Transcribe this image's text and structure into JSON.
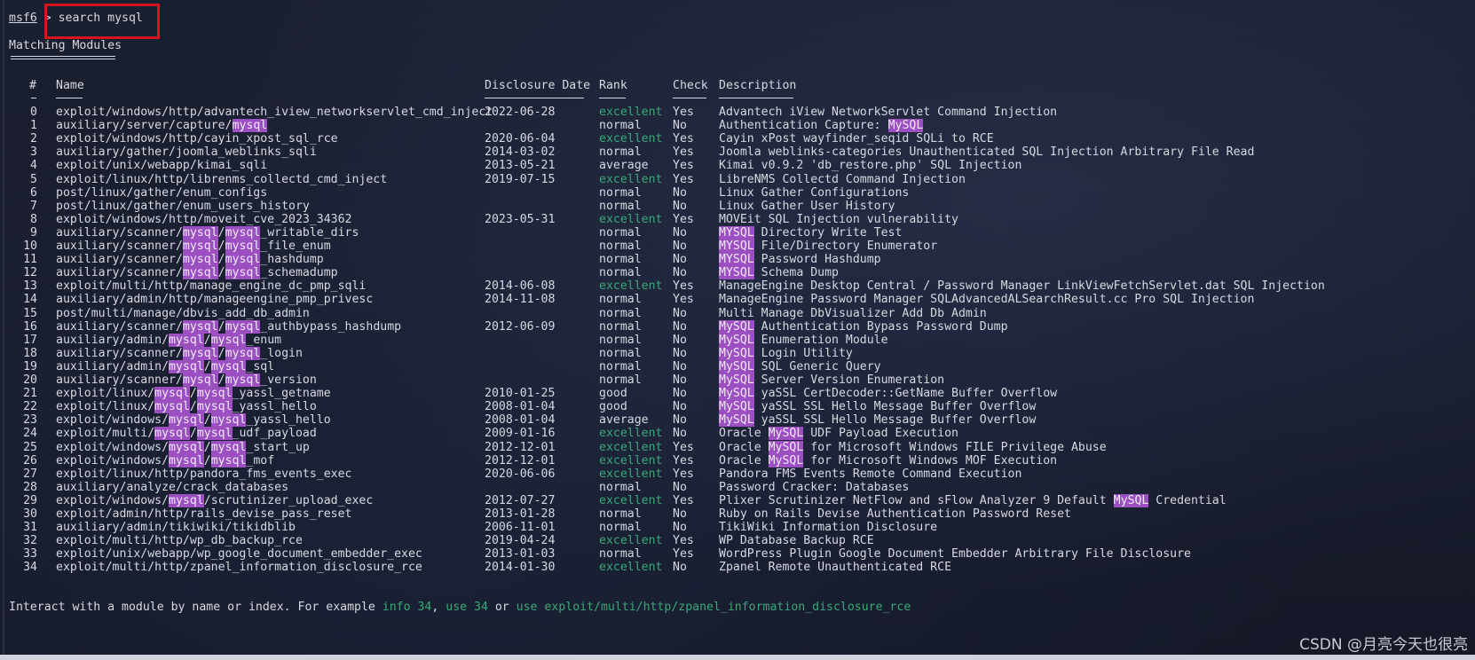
{
  "prompt": {
    "label": "msf6",
    "sep": " > ",
    "command": "search mysql"
  },
  "section_title": "Matching Modules",
  "columns": {
    "num": "#",
    "name": "Name",
    "date": "Disclosure Date",
    "rank": "Rank",
    "check": "Check",
    "desc": "Description"
  },
  "search_term": "mysql",
  "highlight_color": "#9b4fc0",
  "rank_excellent_color": "#3aa876",
  "rows": [
    {
      "n": "0",
      "name": "exploit/windows/http/advantech_iview_networkservlet_cmd_inject",
      "date": "2022-06-28",
      "rank": "excellent",
      "check": "Yes",
      "desc": "Advantech iView NetworkServlet Command Injection"
    },
    {
      "n": "1",
      "name": "auxiliary/server/capture/mysql",
      "date": "",
      "rank": "normal",
      "check": "No",
      "desc": "Authentication Capture: MySQL"
    },
    {
      "n": "2",
      "name": "exploit/windows/http/cayin_xpost_sql_rce",
      "date": "2020-06-04",
      "rank": "excellent",
      "check": "Yes",
      "desc": "Cayin xPost wayfinder_seqid SQLi to RCE"
    },
    {
      "n": "3",
      "name": "auxiliary/gather/joomla_weblinks_sqli",
      "date": "2014-03-02",
      "rank": "normal",
      "check": "Yes",
      "desc": "Joomla weblinks-categories Unauthenticated SQL Injection Arbitrary File Read"
    },
    {
      "n": "4",
      "name": "exploit/unix/webapp/kimai_sqli",
      "date": "2013-05-21",
      "rank": "average",
      "check": "Yes",
      "desc": "Kimai v0.9.2 'db_restore.php' SQL Injection"
    },
    {
      "n": "5",
      "name": "exploit/linux/http/librenms_collectd_cmd_inject",
      "date": "2019-07-15",
      "rank": "excellent",
      "check": "Yes",
      "desc": "LibreNMS Collectd Command Injection"
    },
    {
      "n": "6",
      "name": "post/linux/gather/enum_configs",
      "date": "",
      "rank": "normal",
      "check": "No",
      "desc": "Linux Gather Configurations"
    },
    {
      "n": "7",
      "name": "post/linux/gather/enum_users_history",
      "date": "",
      "rank": "normal",
      "check": "No",
      "desc": "Linux Gather User History"
    },
    {
      "n": "8",
      "name": "exploit/windows/http/moveit_cve_2023_34362",
      "date": "2023-05-31",
      "rank": "excellent",
      "check": "Yes",
      "desc": "MOVEit SQL Injection vulnerability"
    },
    {
      "n": "9",
      "name": "auxiliary/scanner/mysql/mysql_writable_dirs",
      "date": "",
      "rank": "normal",
      "check": "No",
      "desc": "MYSQL Directory Write Test"
    },
    {
      "n": "10",
      "name": "auxiliary/scanner/mysql/mysql_file_enum",
      "date": "",
      "rank": "normal",
      "check": "No",
      "desc": "MYSQL File/Directory Enumerator"
    },
    {
      "n": "11",
      "name": "auxiliary/scanner/mysql/mysql_hashdump",
      "date": "",
      "rank": "normal",
      "check": "No",
      "desc": "MYSQL Password Hashdump"
    },
    {
      "n": "12",
      "name": "auxiliary/scanner/mysql/mysql_schemadump",
      "date": "",
      "rank": "normal",
      "check": "No",
      "desc": "MYSQL Schema Dump"
    },
    {
      "n": "13",
      "name": "exploit/multi/http/manage_engine_dc_pmp_sqli",
      "date": "2014-06-08",
      "rank": "excellent",
      "check": "Yes",
      "desc": "ManageEngine Desktop Central / Password Manager LinkViewFetchServlet.dat SQL Injection"
    },
    {
      "n": "14",
      "name": "auxiliary/admin/http/manageengine_pmp_privesc",
      "date": "2014-11-08",
      "rank": "normal",
      "check": "Yes",
      "desc": "ManageEngine Password Manager SQLAdvancedALSearchResult.cc Pro SQL Injection"
    },
    {
      "n": "15",
      "name": "post/multi/manage/dbvis_add_db_admin",
      "date": "",
      "rank": "normal",
      "check": "No",
      "desc": "Multi Manage DbVisualizer Add Db Admin"
    },
    {
      "n": "16",
      "name": "auxiliary/scanner/mysql/mysql_authbypass_hashdump",
      "date": "2012-06-09",
      "rank": "normal",
      "check": "No",
      "desc": "MySQL Authentication Bypass Password Dump"
    },
    {
      "n": "17",
      "name": "auxiliary/admin/mysql/mysql_enum",
      "date": "",
      "rank": "normal",
      "check": "No",
      "desc": "MySQL Enumeration Module"
    },
    {
      "n": "18",
      "name": "auxiliary/scanner/mysql/mysql_login",
      "date": "",
      "rank": "normal",
      "check": "No",
      "desc": "MySQL Login Utility"
    },
    {
      "n": "19",
      "name": "auxiliary/admin/mysql/mysql_sql",
      "date": "",
      "rank": "normal",
      "check": "No",
      "desc": "MySQL SQL Generic Query"
    },
    {
      "n": "20",
      "name": "auxiliary/scanner/mysql/mysql_version",
      "date": "",
      "rank": "normal",
      "check": "No",
      "desc": "MySQL Server Version Enumeration"
    },
    {
      "n": "21",
      "name": "exploit/linux/mysql/mysql_yassl_getname",
      "date": "2010-01-25",
      "rank": "good",
      "check": "No",
      "desc": "MySQL yaSSL CertDecoder::GetName Buffer Overflow"
    },
    {
      "n": "22",
      "name": "exploit/linux/mysql/mysql_yassl_hello",
      "date": "2008-01-04",
      "rank": "good",
      "check": "No",
      "desc": "MySQL yaSSL SSL Hello Message Buffer Overflow"
    },
    {
      "n": "23",
      "name": "exploit/windows/mysql/mysql_yassl_hello",
      "date": "2008-01-04",
      "rank": "average",
      "check": "No",
      "desc": "MySQL yaSSL SSL Hello Message Buffer Overflow"
    },
    {
      "n": "24",
      "name": "exploit/multi/mysql/mysql_udf_payload",
      "date": "2009-01-16",
      "rank": "excellent",
      "check": "No",
      "desc": "Oracle MySQL UDF Payload Execution"
    },
    {
      "n": "25",
      "name": "exploit/windows/mysql/mysql_start_up",
      "date": "2012-12-01",
      "rank": "excellent",
      "check": "Yes",
      "desc": "Oracle MySQL for Microsoft Windows FILE Privilege Abuse"
    },
    {
      "n": "26",
      "name": "exploit/windows/mysql/mysql_mof",
      "date": "2012-12-01",
      "rank": "excellent",
      "check": "Yes",
      "desc": "Oracle MySQL for Microsoft Windows MOF Execution"
    },
    {
      "n": "27",
      "name": "exploit/linux/http/pandora_fms_events_exec",
      "date": "2020-06-06",
      "rank": "excellent",
      "check": "Yes",
      "desc": "Pandora FMS Events Remote Command Execution"
    },
    {
      "n": "28",
      "name": "auxiliary/analyze/crack_databases",
      "date": "",
      "rank": "normal",
      "check": "No",
      "desc": "Password Cracker: Databases"
    },
    {
      "n": "29",
      "name": "exploit/windows/mysql/scrutinizer_upload_exec",
      "date": "2012-07-27",
      "rank": "excellent",
      "check": "Yes",
      "desc": "Plixer Scrutinizer NetFlow and sFlow Analyzer 9 Default MySQL Credential"
    },
    {
      "n": "30",
      "name": "exploit/admin/http/rails_devise_pass_reset",
      "date": "2013-01-28",
      "rank": "normal",
      "check": "No",
      "desc": "Ruby on Rails Devise Authentication Password Reset"
    },
    {
      "n": "31",
      "name": "auxiliary/admin/tikiwiki/tikidblib",
      "date": "2006-11-01",
      "rank": "normal",
      "check": "No",
      "desc": "TikiWiki Information Disclosure"
    },
    {
      "n": "32",
      "name": "exploit/multi/http/wp_db_backup_rce",
      "date": "2019-04-24",
      "rank": "excellent",
      "check": "Yes",
      "desc": "WP Database Backup RCE"
    },
    {
      "n": "33",
      "name": "exploit/unix/webapp/wp_google_document_embedder_exec",
      "date": "2013-01-03",
      "rank": "normal",
      "check": "Yes",
      "desc": "WordPress Plugin Google Document Embedder Arbitrary File Disclosure"
    },
    {
      "n": "34",
      "name": "exploit/multi/http/zpanel_information_disclosure_rce",
      "date": "2014-01-30",
      "rank": "excellent",
      "check": "No",
      "desc": "Zpanel Remote Unauthenticated RCE"
    }
  ],
  "footer": {
    "prefix": "Interact with a module by name or index. For example ",
    "ex1": "info 34",
    "sep1": ", ",
    "ex2": "use 34",
    "sep2": " or ",
    "ex3": "use exploit/multi/http/zpanel_information_disclosure_rce"
  },
  "watermark": "CSDN @月亮今天也很亮"
}
